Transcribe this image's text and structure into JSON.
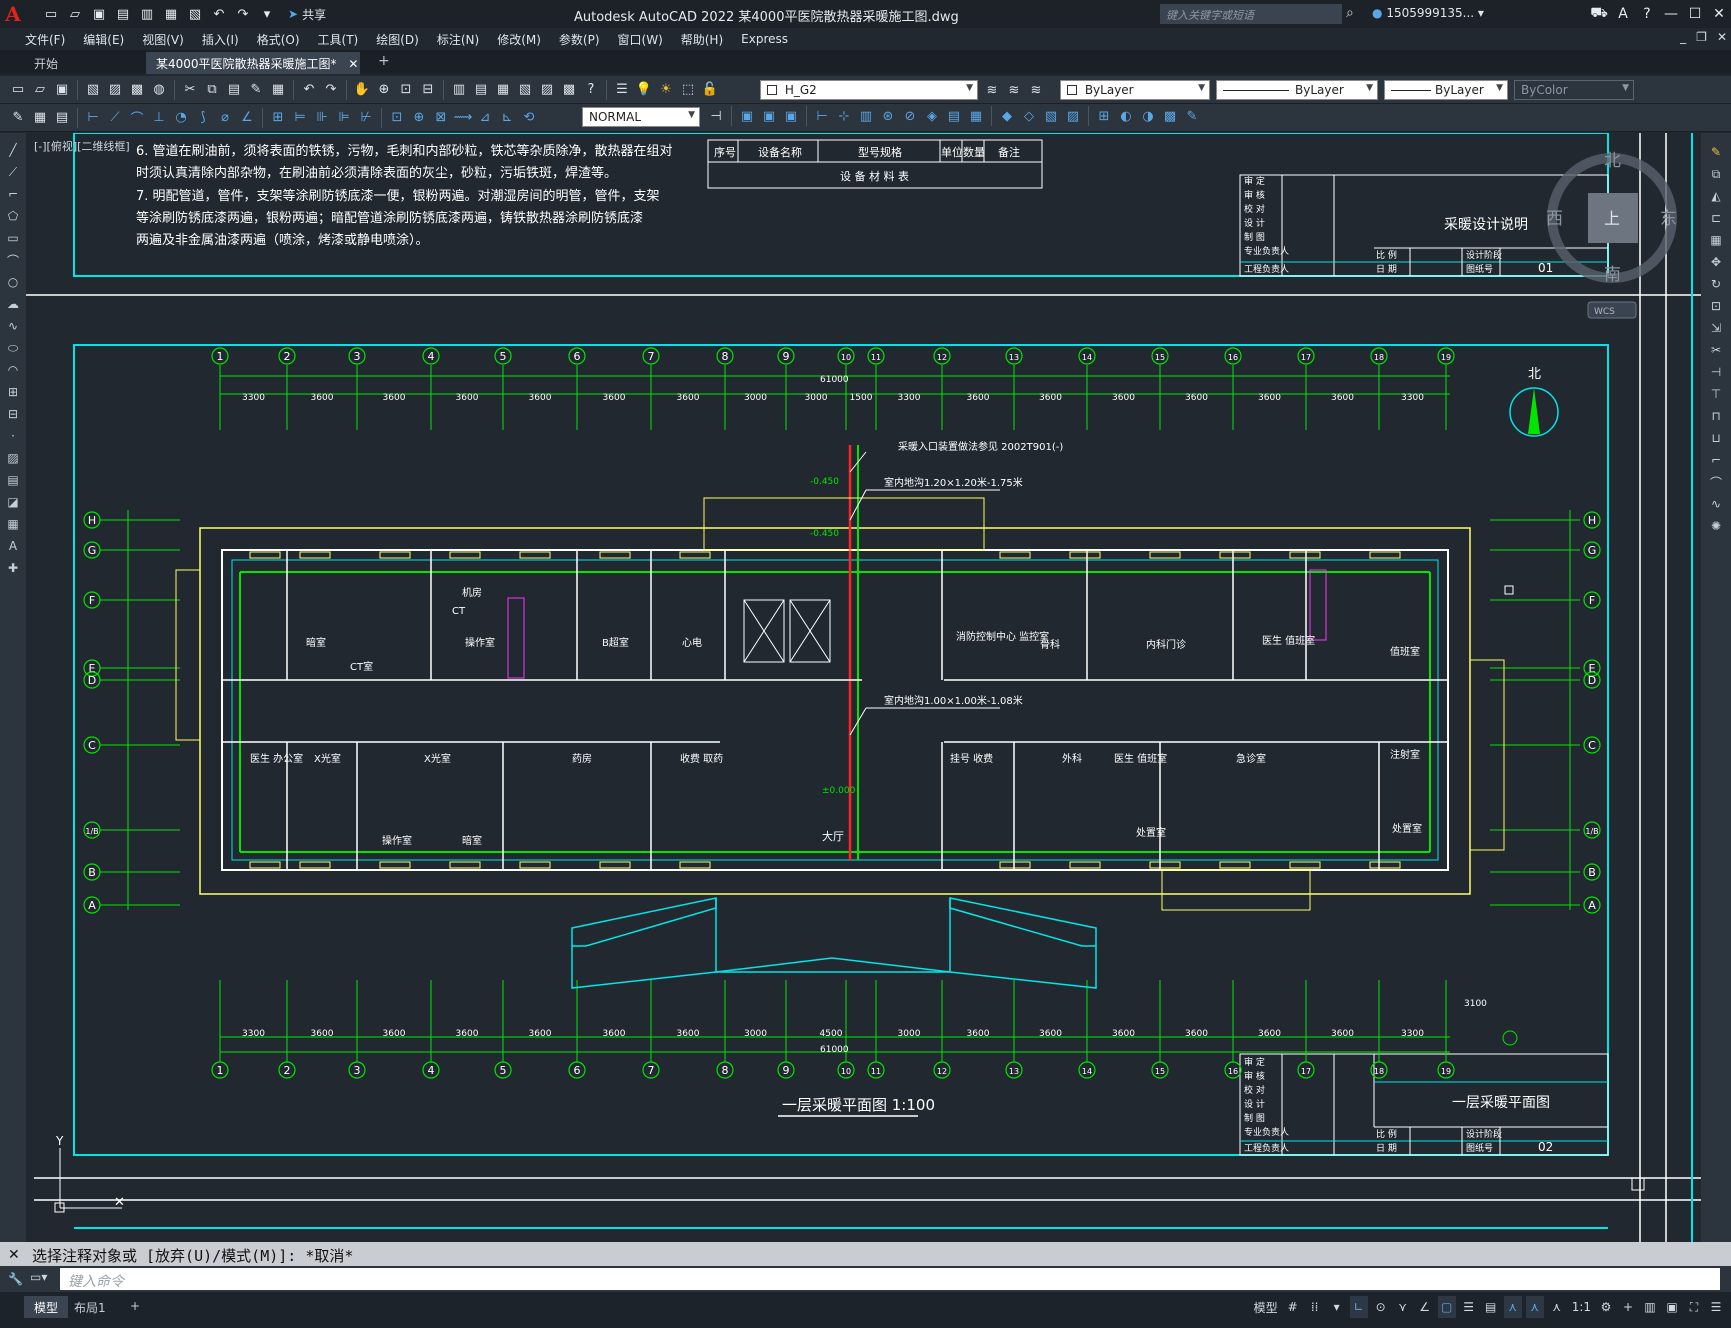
{
  "titlebar": {
    "logo": "A",
    "share_label": "共享",
    "title": "Autodesk AutoCAD 2022    某4000平医院散热器采暖施工图.dwg",
    "search_placeholder": "键入关键字或短语",
    "user": "1505999135... ▾"
  },
  "menu": [
    "文件(F)",
    "编辑(E)",
    "视图(V)",
    "插入(I)",
    "格式(O)",
    "工具(T)",
    "绘图(D)",
    "标注(N)",
    "修改(M)",
    "参数(P)",
    "窗口(W)",
    "帮助(H)",
    "Express"
  ],
  "tabs": {
    "start": "开始",
    "active": "某4000平医院散热器采暖施工图*"
  },
  "toolbar": {
    "layer": "H_G2",
    "color": "ByLayer",
    "linetype": "ByLayer",
    "lineweight": "ByLayer",
    "plotstyle": "ByColor",
    "dimstyle": "NORMAL"
  },
  "viewport": {
    "label": "[-][俯视][二维线框]"
  },
  "viewcube": {
    "north": "北",
    "south": "南",
    "east": "东",
    "west": "西",
    "top": "上",
    "wcs": "WCS"
  },
  "drawing": {
    "notes": [
      "6. 管道在刷油前，须将表面的铁锈，污物，毛刺和内部砂粒，铁芯等杂质除净，散热器在组对",
      "   时须认真清除内部杂物，在刷油前必须清除表面的灰尘，砂粒，污垢铁斑，焊渣等。",
      "7. 明配管道，管件，支架等涂刷防锈底漆一便，银粉两遍。对潮湿房间的明管，管件，支架",
      "   等涂刷防锈底漆两遍，银粉两遍；暗配管道涂刷防锈底漆两遍，铸铁散热器涂刷防锈底漆",
      "   两遍及非金属油漆两遍（喷涂，烤漆或静电喷涂）。"
    ],
    "equipment_table": {
      "headers": [
        "序号",
        "设备名称",
        "型号规格",
        "单位",
        "数量",
        "备注"
      ],
      "caption": "设 备 材 料 表"
    },
    "title_block_1": {
      "rows": [
        "审 定",
        "审 核",
        "校 对",
        "设 计",
        "制 图",
        "专业负责人",
        "工程负责人"
      ],
      "sheet_title": "采暖设计说明",
      "scale_label": "比 例",
      "date_label": "日 期",
      "phase_label": "设计阶段",
      "drawing_no_label": "图纸号",
      "drawing_no": "01"
    },
    "title_block_2": {
      "sheet_title": "一层采暖平面图",
      "scale_label": "比 例",
      "date_label": "日 期",
      "phase_label": "设计阶段",
      "drawing_no_label": "图纸号",
      "drawing_no": "02"
    },
    "plan_title": "一层采暖平面图 1:100",
    "north_label": "北",
    "grid_cols": [
      "1",
      "2",
      "3",
      "4",
      "5",
      "6",
      "7",
      "8",
      "9",
      "10",
      "11",
      "12",
      "13",
      "14",
      "15",
      "16",
      "17",
      "18",
      "19"
    ],
    "grid_rows": [
      "H",
      "G",
      "F",
      "E",
      "D",
      "C",
      "1/B",
      "B",
      "A"
    ],
    "dims_top": [
      "3300",
      "3600",
      "3600",
      "3600",
      "3600",
      "3600",
      "3600",
      "3000",
      "3000",
      "1500",
      "3300",
      "3600",
      "3600",
      "3600",
      "3600",
      "3600",
      "3600",
      "3300"
    ],
    "dims_bottom": [
      "3300",
      "3600",
      "3600",
      "3600",
      "3600",
      "3600",
      "3600",
      "3000",
      "4500",
      "3000",
      "3600",
      "3600",
      "3600",
      "3600",
      "3600",
      "3600",
      "3300"
    ],
    "total_dim": "61000",
    "right_dim": "3100",
    "annotations": {
      "inlet": "采暖入口装置做法参见 2002T901(-)",
      "trench1": "室内地沟1.20×1.20米-1.75米",
      "trench2": "室内地沟1.00×1.00米-1.08米",
      "elev1": "-0.450",
      "elev2": "-0.450",
      "elev3": "±0.000"
    },
    "rooms": [
      "暗室",
      "CT室",
      "CT",
      "机房",
      "操作室",
      "B超室",
      "心电",
      "消防控制中心\n监控室",
      "骨科",
      "内科门诊",
      "医生\n值班室",
      "值班室",
      "医生\n办公室",
      "X光室",
      "X光室",
      "药房",
      "收费\n取药",
      "挂号\n收费",
      "外科",
      "医生\n值班室",
      "急诊室",
      "注射室",
      "处置室",
      "处置室",
      "操作室",
      "暗室",
      "大厅"
    ]
  },
  "command": {
    "history": "选择注释对象或 [放弃(U)/模式(M)]: *取消*",
    "placeholder": "键入命令"
  },
  "status": {
    "model_tab": "模型",
    "layout_tab": "布局1",
    "model_label": "模型",
    "scale": "1:1"
  }
}
